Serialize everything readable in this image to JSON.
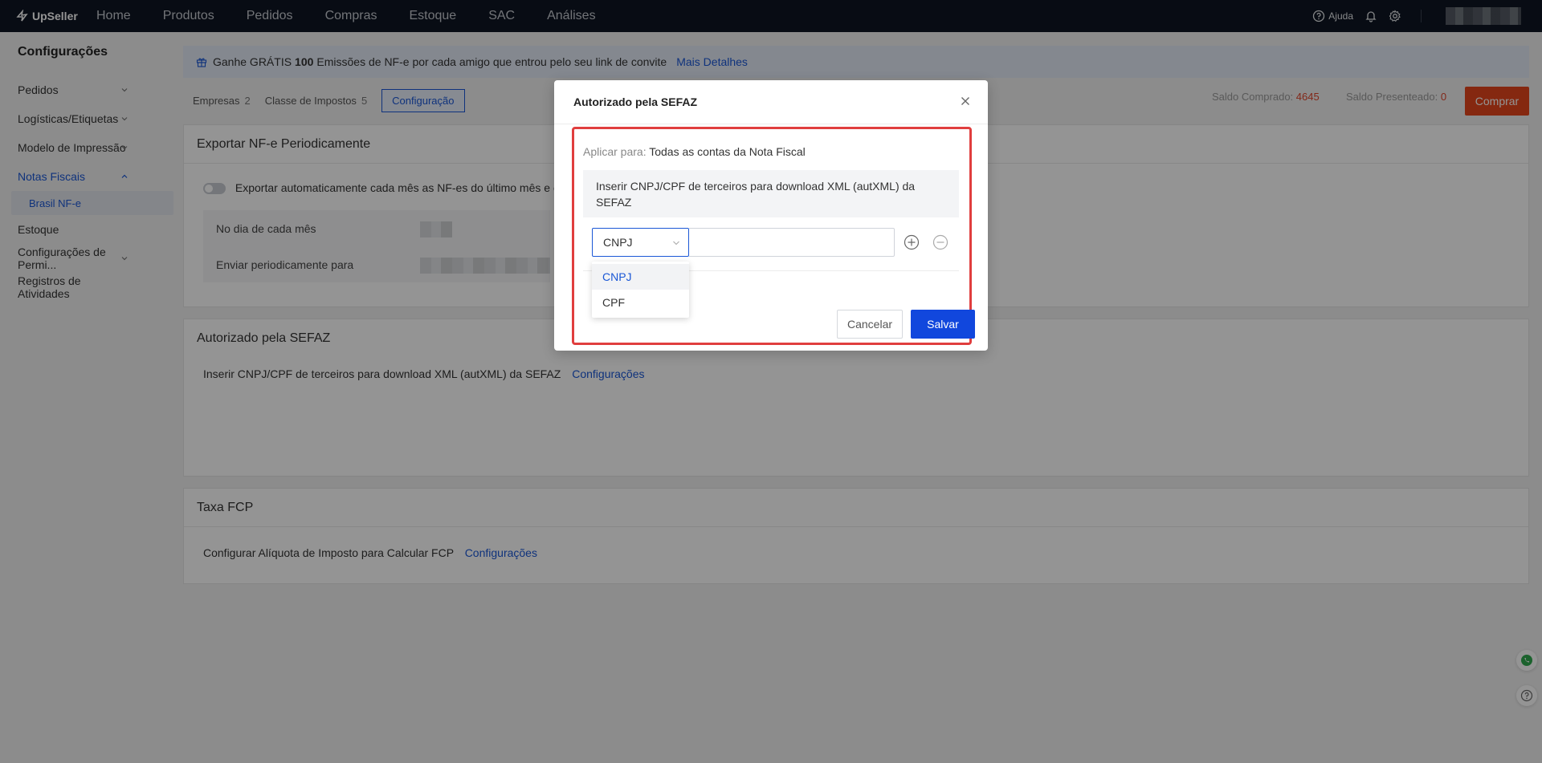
{
  "topnav": {
    "brand": "UpSeller",
    "items": [
      "Home",
      "Produtos",
      "Pedidos",
      "Compras",
      "Estoque",
      "SAC",
      "Análises"
    ],
    "help_label": "Ajuda",
    "icons": [
      "help-icon",
      "bell-icon",
      "gear-icon"
    ]
  },
  "sidebar": {
    "title": "Configurações",
    "items": [
      {
        "label": "Pedidos",
        "expandable": true
      },
      {
        "label": "Logísticas/Etiquetas",
        "expandable": true
      },
      {
        "label": "Modelo de Impressão",
        "expandable": true
      },
      {
        "label": "Notas Fiscais",
        "expandable": true,
        "expanded": true,
        "active": true
      },
      {
        "label": "Estoque",
        "expandable": false
      },
      {
        "label": "Configurações de Permi...",
        "expandable": true
      },
      {
        "label": "Registros de Atividades",
        "expandable": false
      }
    ],
    "sub_item": "Brasil NF-e"
  },
  "banner": {
    "text_before": "Ganhe GRÁTIS",
    "bold": "100",
    "text_after": "Emissões de NF-e por cada amigo que entrou pelo seu link de convite",
    "link": "Mais Detalhes"
  },
  "tabs": [
    {
      "label": "Empresas",
      "count": "2"
    },
    {
      "label": "Classe de Impostos",
      "count": "5"
    },
    {
      "label": "Configuração",
      "count": ""
    }
  ],
  "saldo": {
    "comprado_label": "Saldo Comprado:",
    "comprado_value": "4645",
    "presenteado_label": "Saldo Presenteado:",
    "presenteado_value": "0",
    "buy_label": "Comprar"
  },
  "cards": {
    "export": {
      "title": "Exportar NF-e Periodicamente",
      "toggle_text": "Exportar automaticamente cada mês as NF-es do último mês e e",
      "rows": [
        "No dia de cada mês",
        "Enviar periodicamente para"
      ]
    },
    "sefaz": {
      "title": "Autorizado pela SEFAZ",
      "text": "Inserir CNPJ/CPF de terceiros para download XML (autXML) da SEFAZ",
      "link": "Configurações"
    },
    "fcp": {
      "title": "Taxa FCP",
      "text": "Configurar Alíquota de Imposto para Calcular FCP",
      "link": "Configurações"
    }
  },
  "modal": {
    "title": "Autorizado pela SEFAZ",
    "apply_label": "Aplicar para:",
    "apply_value": "Todas as contas da Nota Fiscal",
    "info": "Inserir CNPJ/CPF de terceiros para download XML (autXML) da SEFAZ",
    "select_value": "CNPJ",
    "input_value": "",
    "options": [
      "CNPJ",
      "CPF"
    ],
    "cancel_label": "Cancelar",
    "save_label": "Salvar"
  },
  "colors": {
    "nav_bg": "#0e1623",
    "accent": "#1a57d6",
    "buy": "#e5461c",
    "save": "#1147dd",
    "highlight_border": "#e03e3e"
  }
}
